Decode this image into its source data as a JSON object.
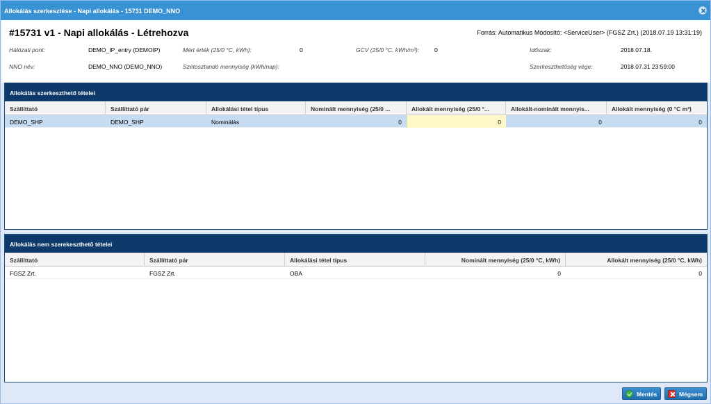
{
  "window": {
    "title": "Allokálás szerkesztése - Napi allokálás - 15731 DEMO_NNO"
  },
  "header": {
    "heading": "#15731 v1 - Napi allokálás - Létrehozva",
    "source": "Forrás: Automatikus Módosító: <ServiceUser> (FGSZ Zrt.) (2018.07.19 13:31:19)",
    "fields": {
      "network_point_label": "Hálózati pont:",
      "network_point_value": "DEMO_IP_entry (DEMOIP)",
      "measured_label": "Mért érték (25/0 °C, kWh):",
      "measured_value": "0",
      "gcv_label": "GCV (25/0 °C, kWh/m³):",
      "gcv_value": "0",
      "period_label": "Időszak:",
      "period_value": "2018.07.18.",
      "nno_label": "NNO név:",
      "nno_value": "DEMO_NNO (DEMO_NNO)",
      "distributable_label": "Szétosztandó mennyiség (kWh/nap):",
      "distributable_value": "",
      "edit_end_label": "Szerkeszthetőség vége:",
      "edit_end_value": "2018.07.31 23:59:00"
    }
  },
  "editable_panel": {
    "title": "Allokálás szerkeszthető tételei",
    "columns": [
      "Szállíttató",
      "Szállíttató pár",
      "Allokálási tétel típus",
      "Nominált mennyiség (25/0 ...",
      "Allokált mennyiség (25/0 °...",
      "Allokált-nominált mennyis...",
      "Allokált mennyiség (0 °C m³)"
    ],
    "rows": [
      [
        "DEMO_SHP",
        "DEMO_SHP",
        "Nominálás",
        "0",
        "0",
        "0",
        "0"
      ]
    ]
  },
  "readonly_panel": {
    "title": "Allokálás nem szerekeszthető tételei",
    "columns": [
      "Szállíttató",
      "Szállíttató pár",
      "Allokálási tétel típus",
      "Nominált mennyiség (25/0 °C, kWh)",
      "Allokált mennyiség (25/0 °C, kWh)"
    ],
    "rows": [
      [
        "FGSZ Zrt.",
        "FGSZ Zrt.",
        "OBA",
        "0",
        "0"
      ]
    ]
  },
  "footer": {
    "save_label": "Mentés",
    "cancel_label": "Mégsem"
  }
}
